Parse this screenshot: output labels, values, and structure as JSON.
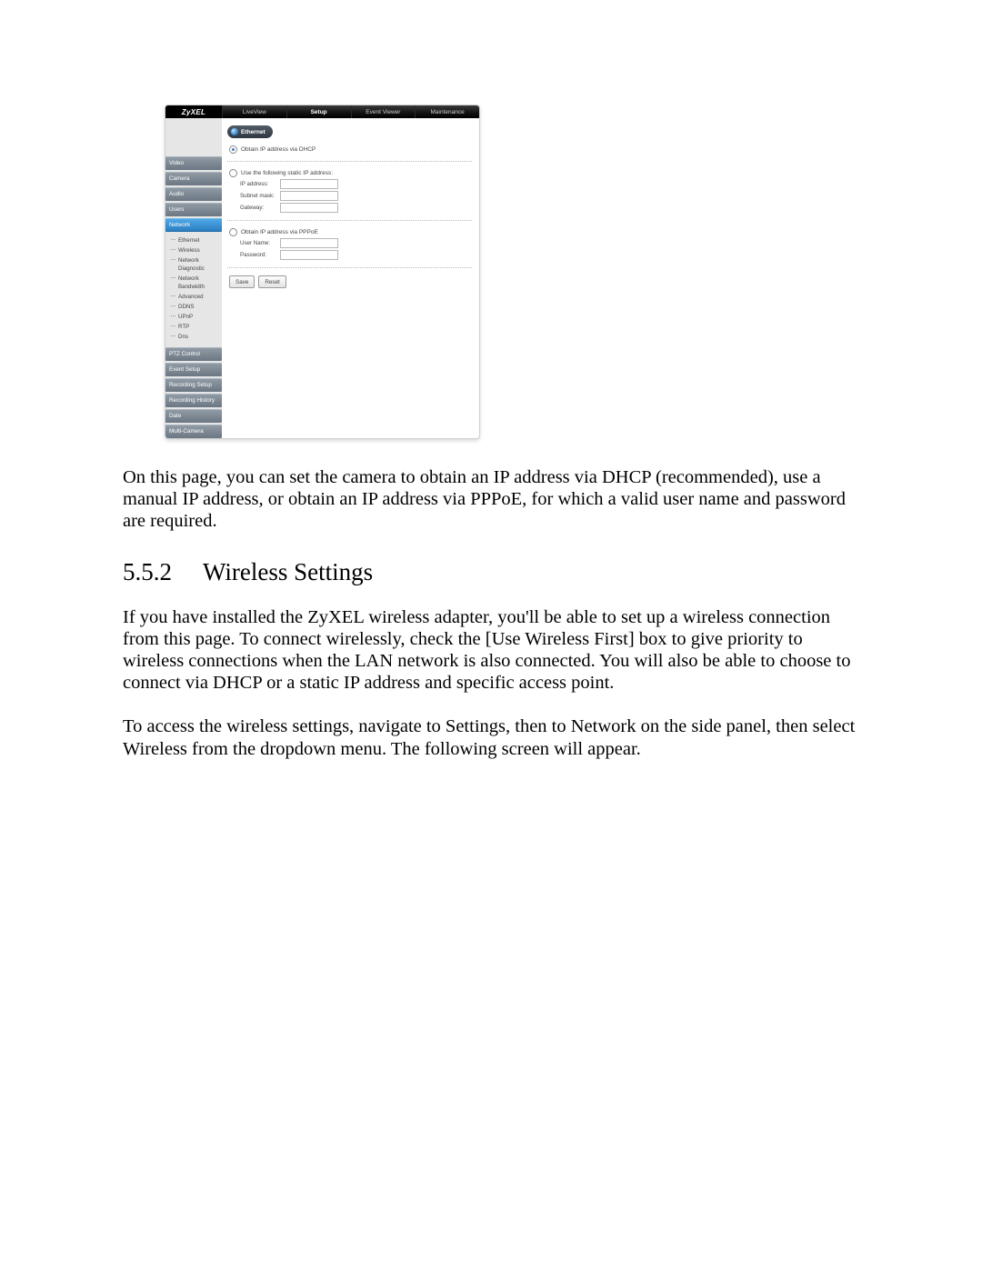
{
  "shot": {
    "brand": "ZyXEL",
    "nav": {
      "liveview": "LiveView",
      "setup": "Setup",
      "eventviewer": "Event Viewer",
      "maintenance": "Maintenance"
    },
    "side": {
      "video": "Video",
      "camera": "Camera",
      "audio": "Audio",
      "users": "Users",
      "network": "Network",
      "ptz": "PTZ Control",
      "event": "Event Setup",
      "recsetup": "Recording Setup",
      "rechistory": "Recording History",
      "date": "Date",
      "multicam": "Multi-Camera"
    },
    "tree": {
      "ethernet": "Ethernet",
      "wireless": "Wireless",
      "diag": "Network Diagnostic",
      "bandwidth": "Network Bandwidth",
      "advanced": "Advanced",
      "ddns": "DDNS",
      "upnp": "UPnP",
      "rtp": "RTP",
      "dns": "Dns"
    },
    "panel": {
      "tab": "Ethernet",
      "opt_dhcp": "Obtain IP address via DHCP",
      "opt_static": "Use the following static IP address:",
      "ip": "IP address:",
      "subnet": "Subnet mask:",
      "gateway": "Gateway:",
      "opt_pppoe": "Obtain IP address via PPPoE",
      "user": "User Name:",
      "pass": "Password:",
      "save": "Save",
      "reset": "Reset"
    }
  },
  "doc": {
    "p1": "On this page, you can set the camera to obtain an IP address via DHCP (recommended), use a manual IP address, or obtain an IP address via PPPoE, for which a valid user name and password are required.",
    "sec_num": "5.5.2",
    "sec_title": "Wireless Settings",
    "p2": "If you have installed the ZyXEL wireless adapter, you'll be able to set up a wireless connection from this page. To connect wirelessly, check the [Use Wireless First] box to give priority to wireless connections when the LAN network is also connected. You will also be able to choose to connect via DHCP or a static IP address and specific access point.",
    "p3": "To access the wireless settings, navigate to Settings, then to Network on the side panel, then select Wireless from the dropdown menu. The following screen will appear."
  }
}
